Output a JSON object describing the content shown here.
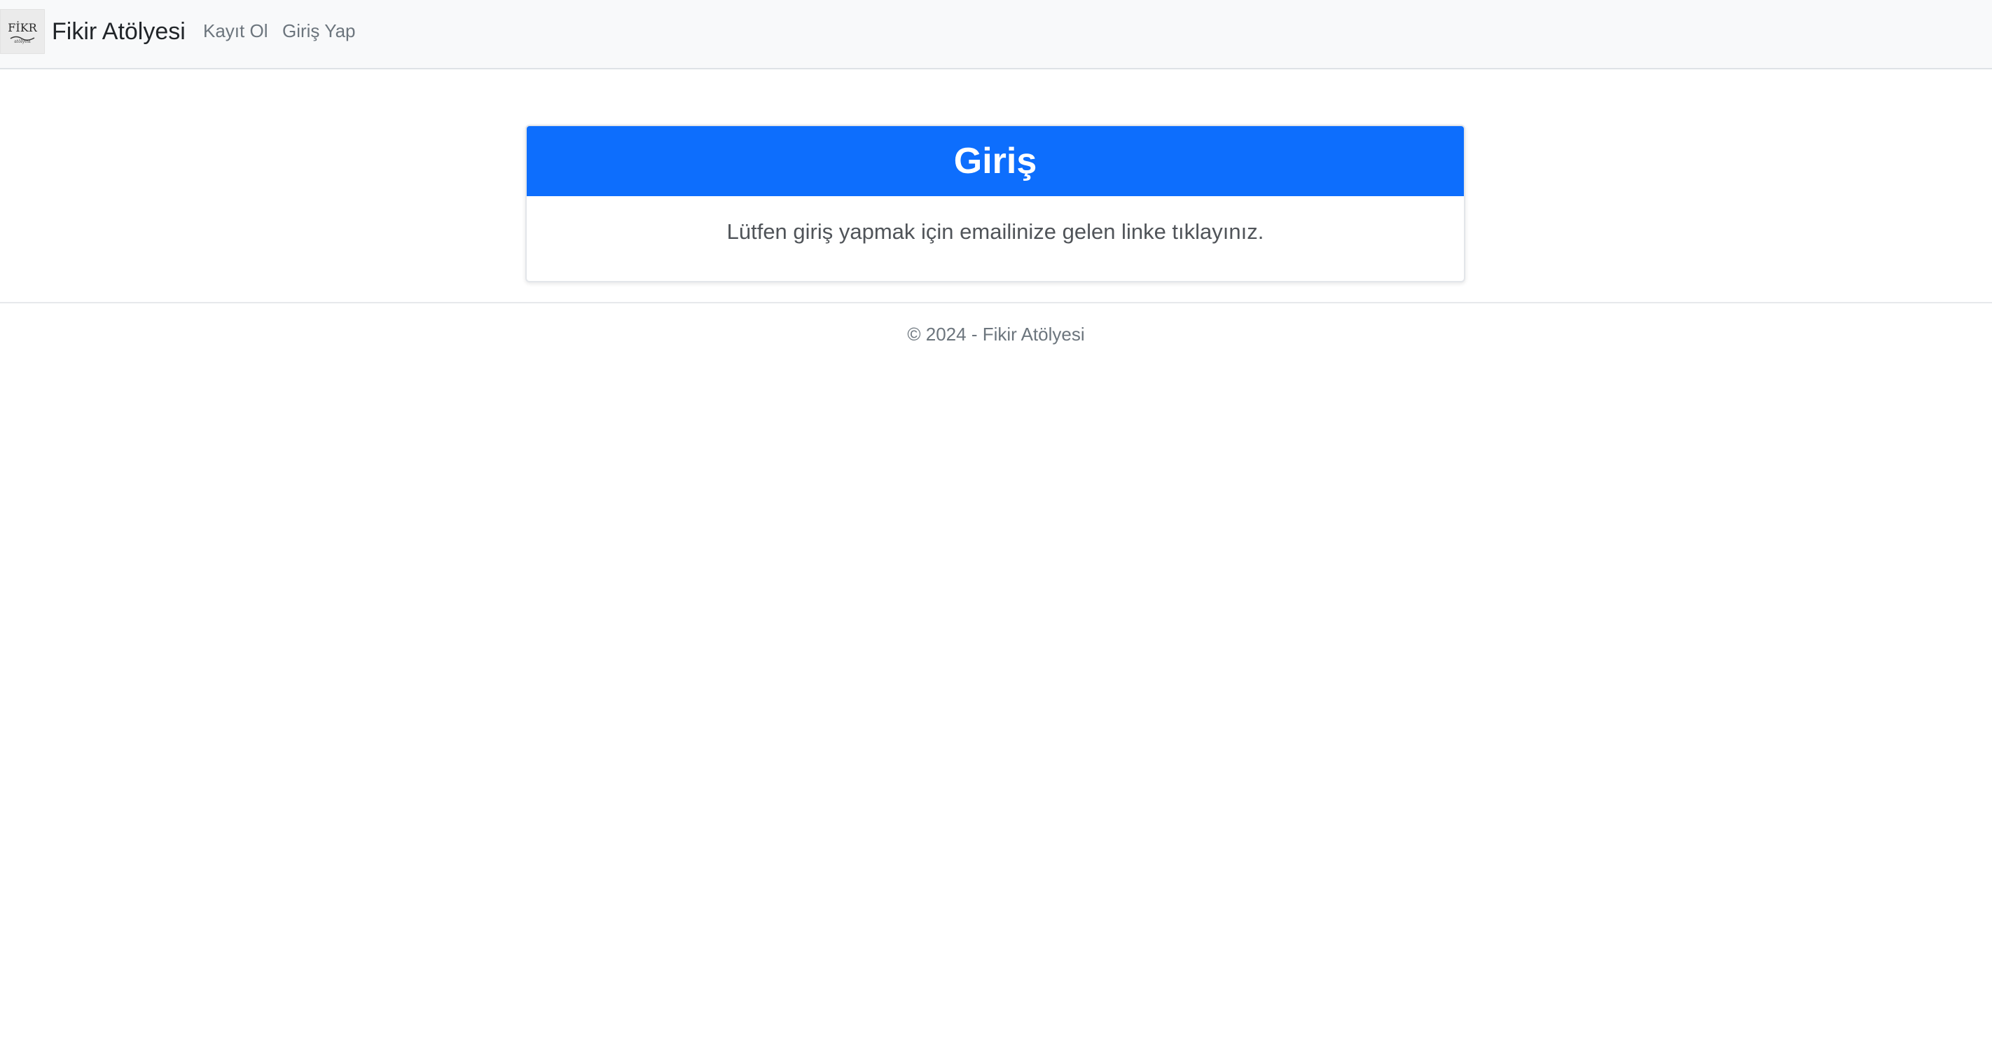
{
  "navbar": {
    "brand_name": "Fikir Atölyesi",
    "logo_text": "FİKR",
    "logo_subtext": "atölyesi",
    "links": [
      {
        "label": "Kayıt Ol"
      },
      {
        "label": "Giriş Yap"
      }
    ]
  },
  "card": {
    "title": "Giriş",
    "message": "Lütfen giriş yapmak için emailinize gelen linke tıklayınız.",
    "header_color": "#0d6efd"
  },
  "footer": {
    "text": "© 2024 - Fikir Atölyesi"
  },
  "icons": {
    "logo": "fikir-atolyesi-logo-icon"
  }
}
